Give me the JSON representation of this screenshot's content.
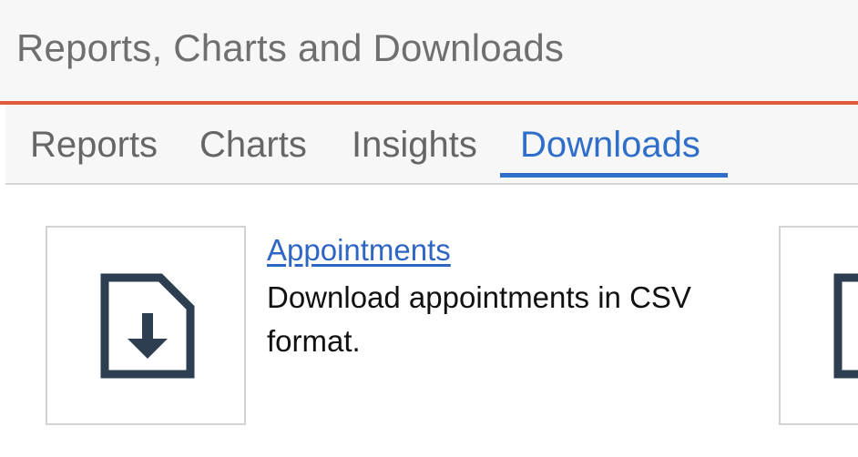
{
  "header": {
    "title": "Reports, Charts and Downloads"
  },
  "tabs": [
    {
      "label": "Reports",
      "active": false
    },
    {
      "label": "Charts",
      "active": false
    },
    {
      "label": "Insights",
      "active": false
    },
    {
      "label": "Downloads",
      "active": true
    }
  ],
  "cards": [
    {
      "icon": "file-download-icon",
      "title": "Appointments",
      "description": "Download appointments in CSV format."
    },
    {
      "icon": "file-download-icon"
    }
  ],
  "colors": {
    "accent_orange": "#e05a3c",
    "tab_active": "#2f6fc9",
    "link": "#2f66c4",
    "icon": "#2c3e50"
  }
}
